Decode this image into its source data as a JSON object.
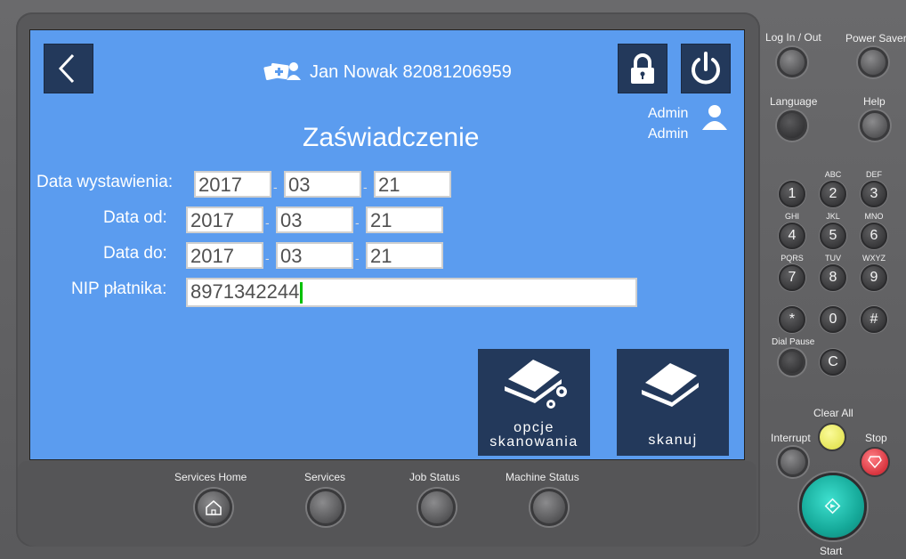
{
  "header": {
    "user_name": "Jan Nowak 82081206959",
    "admin_line1": "Admin",
    "admin_line2": "Admin"
  },
  "title": "Zaświadczenie",
  "form": {
    "issue_date_label": "Data wystawienia:",
    "issue_date": {
      "year": "2017",
      "month": "03",
      "day": "21"
    },
    "date_from_label": "Data od:",
    "date_from": {
      "year": "2017",
      "month": "03",
      "day": "21"
    },
    "date_to_label": "Data do:",
    "date_to": {
      "year": "2017",
      "month": "03",
      "day": "21"
    },
    "nip_label": "NIP płatnika:",
    "nip_value": "8971342244",
    "separator": "-"
  },
  "actions": {
    "scan_options_line1": "opcje",
    "scan_options_line2": "skanowania",
    "scan_label": "skanuj"
  },
  "hardware": {
    "login_label": "Log In / Out",
    "power_saver_label": "Power Saver",
    "language_label": "Language",
    "help_label": "Help",
    "dial_pause_label": "Dial Pause",
    "clear_all_label": "Clear All",
    "interrupt_label": "Interrupt",
    "stop_label": "Stop",
    "start_label": "Start",
    "keys": [
      {
        "key": "1",
        "sub": ""
      },
      {
        "key": "2",
        "sub": "ABC"
      },
      {
        "key": "3",
        "sub": "DEF"
      },
      {
        "key": "4",
        "sub": "GHI"
      },
      {
        "key": "5",
        "sub": "JKL"
      },
      {
        "key": "6",
        "sub": "MNO"
      },
      {
        "key": "7",
        "sub": "PQRS"
      },
      {
        "key": "8",
        "sub": "TUV"
      },
      {
        "key": "9",
        "sub": "WXYZ"
      },
      {
        "key": "*",
        "sub": ""
      },
      {
        "key": "0",
        "sub": ""
      },
      {
        "key": "#",
        "sub": ""
      }
    ],
    "c_key": "C",
    "bottom": {
      "services_home": "Services Home",
      "services": "Services",
      "job_status": "Job Status",
      "machine_status": "Machine Status"
    }
  },
  "colors": {
    "screen": "#5b9cef",
    "button_dark": "#23395b",
    "cursor": "#00c000",
    "clear_all": "#ecec6a",
    "stop": "#e0444e",
    "start": "#19b7a6"
  }
}
